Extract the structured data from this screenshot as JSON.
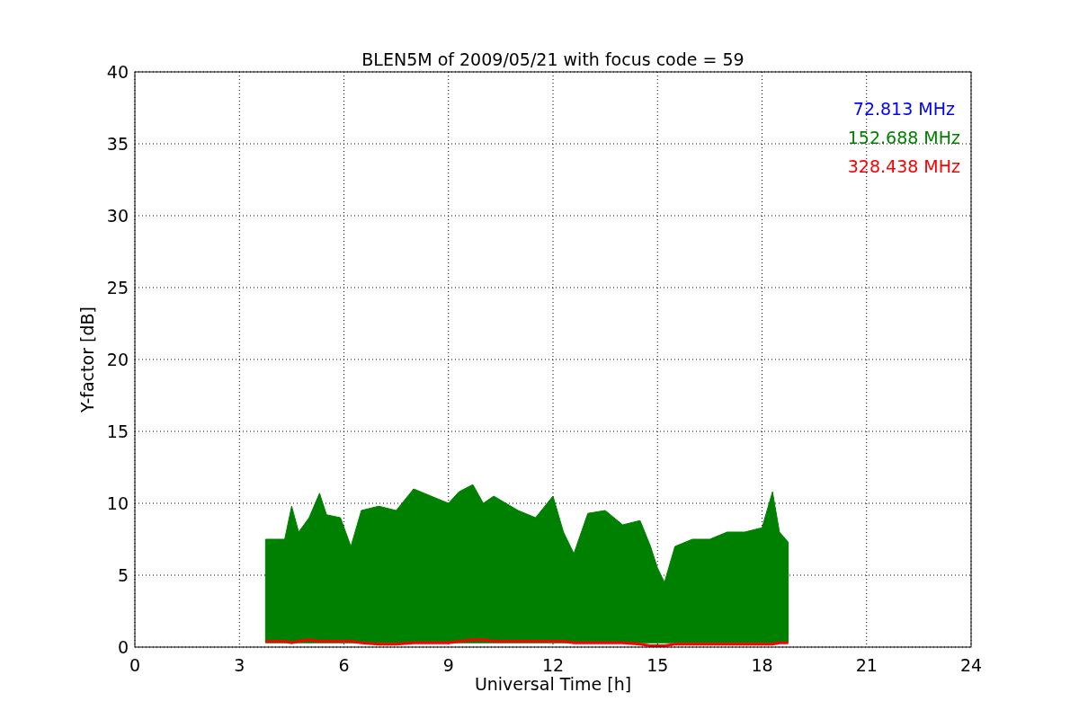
{
  "figure": {
    "chart_data": {
      "type": "area",
      "title": "BLEN5M of 2009/05/21 with focus code = 59",
      "xlabel": "Universal Time [h]",
      "ylabel": "Y-factor [dB]",
      "x": [
        3.75,
        4.3,
        4.5,
        4.7,
        5,
        5.3,
        5.5,
        5.9,
        6.2,
        6.5,
        7,
        7.5,
        8,
        8.5,
        9,
        9.3,
        9.7,
        10,
        10.3,
        11,
        11.5,
        12,
        12.3,
        12.6,
        13,
        13.5,
        14,
        14.5,
        14.8,
        15,
        15.2,
        15.5,
        16,
        16.5,
        17,
        17.5,
        18,
        18.3,
        18.5,
        18.75
      ],
      "series": [
        {
          "name": "152.688 MHz",
          "type": "area",
          "color": "#008000",
          "values": [
            7.5,
            7.5,
            9.8,
            8,
            9,
            10.7,
            9.2,
            9,
            7,
            9.5,
            9.8,
            9.5,
            11,
            10.5,
            10,
            10.8,
            11.3,
            10,
            10.5,
            9.5,
            9,
            10.5,
            8,
            6.5,
            9.3,
            9.5,
            8.5,
            8.8,
            7,
            5.5,
            4.5,
            7,
            7.5,
            7.5,
            8,
            8,
            8.3,
            10.8,
            8,
            7.3
          ]
        },
        {
          "name": "328.438 MHz",
          "type": "line",
          "color": "#ff0000",
          "values": [
            0.4,
            0.4,
            0.3,
            0.4,
            0.5,
            0.4,
            0.4,
            0.4,
            0.4,
            0.3,
            0.2,
            0.2,
            0.3,
            0.3,
            0.3,
            0.4,
            0.5,
            0.5,
            0.4,
            0.4,
            0.4,
            0.4,
            0.4,
            0.3,
            0.3,
            0.3,
            0.3,
            0.2,
            0.1,
            0.1,
            0.1,
            0.2,
            0.2,
            0.2,
            0.2,
            0.2,
            0.2,
            0.2,
            0.3,
            0.3
          ]
        }
      ],
      "grid": true,
      "xlim": [
        0,
        24
      ],
      "ylim": [
        0,
        40
      ],
      "xticks": [
        0,
        3,
        6,
        9,
        12,
        15,
        18,
        21,
        24
      ],
      "yticks": [
        0,
        5,
        10,
        15,
        20,
        25,
        30,
        35,
        40
      ]
    },
    "legend": [
      {
        "label": "72.813 MHz",
        "color": "#0000ff"
      }
    ]
  }
}
